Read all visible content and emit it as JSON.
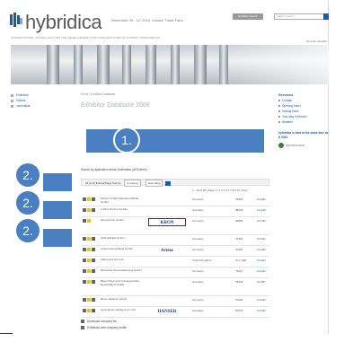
{
  "header": {
    "logo_text": "hybridica",
    "date_text": "November 09 - 12, 2010, Munich Trade Fairs",
    "tagline": "INTERNATIONAL TRADE FAIR FOR THE DEVELOPMENT AND MANUFACTURE OF HYBRID COMPONENTS",
    "top_button": "Exhibitor search",
    "search_placeholder": "Fulltext search",
    "lang": "Deutsch | English"
  },
  "nav": {
    "items": [
      "Exhibitors",
      "Visitors",
      "Journalists"
    ]
  },
  "main": {
    "breadcrumb": "Home › Exhibitor Database",
    "heading": "Exhibitor Database 2008",
    "filter_label": "Search by application areas Information (All Entries)",
    "filter_bar": {
      "prefix": "All (A-Z) Entries/Page",
      "sort_label": "Sort by:",
      "sort_value": "Company",
      "order_value": "ascending"
    },
    "pager": "1 - 10 of 25 | Page 1 | 2 3 4 5 6 7 8 9 10 | Next",
    "rows": [
      {
        "name": "Partner GmbH Maschinenfabrik GmbH",
        "logo": "",
        "country": "Germany",
        "zip": "73893",
        "more": "C2.460"
      },
      {
        "name": "A-Plus AG Formenbau",
        "logo": "",
        "country": "Germany",
        "zip": "88045",
        "more": "C2.416"
      },
      {
        "name": "ahrend-kron GmbH",
        "logo": "KRON",
        "country": "Germany",
        "zip": "44866",
        "more": "C2.330"
      },
      {
        "name": "AMS ESLEX GmbH",
        "logo": "",
        "country": "Germany",
        "zip": "75181",
        "more": "C2.402"
      },
      {
        "name": "Arteos Deutschland GmbH",
        "logo": "Arteos",
        "country": "Germany",
        "zip": "47906",
        "more": "C2.466"
      },
      {
        "name": "Atkins and Hoo Ltd.",
        "logo": "",
        "country": "United Kingdom",
        "zip": "SL7 1NE",
        "more": "C2.463"
      },
      {
        "name": "Bernecker Automatisierung GmbH",
        "logo": "",
        "country": "Germany",
        "zip": "79417",
        "more": "C2.422"
      },
      {
        "name": "Bayer Polymerforschungsinstitut Deutschland GmbH",
        "logo": "",
        "country": "Germany",
        "zip": "75203",
        "more": "C2.487"
      },
      {
        "name": "Bruno Reißner GmbH",
        "logo": "",
        "country": "Germany",
        "zip": "70469",
        "more": "C2.403"
      },
      {
        "name": "Carl Hanser Verlag & Co. KG",
        "logo": "HANSER",
        "country": "Germany",
        "zip": "81679",
        "more": "C2.459"
      }
    ],
    "footer_links": [
      "Download company list",
      "Exhibitors with company profile"
    ]
  },
  "right": {
    "title": "Services",
    "links": [
      "Contact",
      "Opening hours",
      "Getting there",
      "Your stay in Munich",
      "Weather"
    ],
    "news": "hybridica is held at the same time as K 2010",
    "twitter": "hybridica.news"
  },
  "overlays": {
    "marker_1": "1.",
    "marker_2a": "2.",
    "marker_2b": "2.",
    "marker_2c": "2."
  },
  "colors": {
    "brand_blue": "#1a5aa6",
    "overlay_blue": "#4a7fc1"
  }
}
